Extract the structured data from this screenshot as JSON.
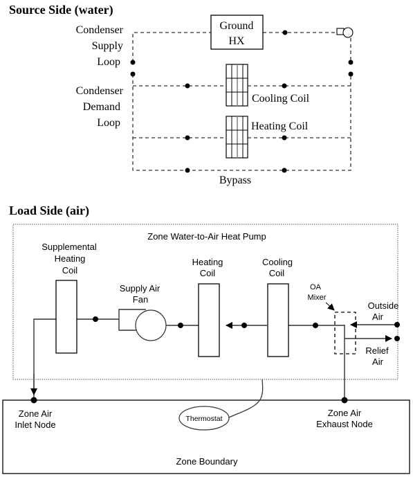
{
  "source_side": {
    "title": "Source Side (water)",
    "supply_loop_label": [
      "Condenser",
      "Supply",
      "Loop"
    ],
    "demand_loop_label": [
      "Condenser",
      "Demand",
      "Loop"
    ],
    "ground_hx_label": [
      "Ground",
      "HX"
    ],
    "cooling_coil_label": "Cooling Coil",
    "heating_coil_label": "Heating Coil",
    "bypass_label": "Bypass",
    "pump_icon": "pump-icon"
  },
  "load_side": {
    "title": "Load Side (air)",
    "heat_pump_label": "Zone Water-to-Air Heat Pump",
    "supplemental_coil_label": [
      "Supplemental",
      "Heating",
      "Coil"
    ],
    "fan_label": [
      "Supply Air",
      "Fan"
    ],
    "heating_coil_label": [
      "Heating",
      "Coil"
    ],
    "cooling_coil_label": [
      "Cooling",
      "Coil"
    ],
    "oa_mixer_label": [
      "OA",
      "Mixer"
    ],
    "outside_air_label": [
      "Outside",
      "Air"
    ],
    "relief_air_label": [
      "Relief",
      "Air"
    ],
    "zone_inlet_label": [
      "Zone Air",
      "Inlet Node"
    ],
    "zone_exhaust_label": [
      "Zone Air",
      "Exhaust Node"
    ],
    "thermostat_label": "Thermostat",
    "zone_boundary_label": "Zone Boundary"
  }
}
